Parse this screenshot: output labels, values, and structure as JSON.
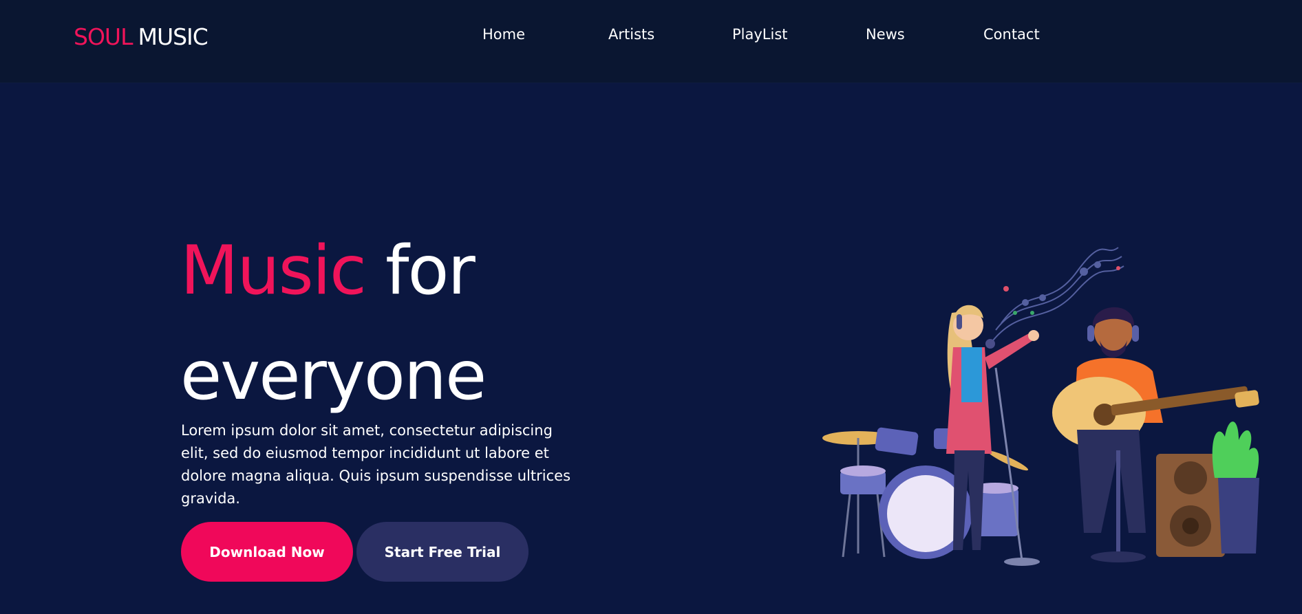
{
  "brand": {
    "part1": "SOUL",
    "part2": "MUSIC"
  },
  "nav": {
    "items": [
      {
        "label": "Home"
      },
      {
        "label": "Artists"
      },
      {
        "label": "PlayList"
      },
      {
        "label": "News"
      },
      {
        "label": "Contact"
      }
    ]
  },
  "hero": {
    "title_accent": "Music",
    "title_rest": "for",
    "title_line2": "everyone",
    "description": "Lorem ipsum dolor sit amet, consectetur adipiscing elit, sed do eiusmod tempor incididunt ut labore et dolore magna aliqua. Quis ipsum suspendisse ultrices gravida.",
    "primary_cta": "Download Now",
    "secondary_cta": "Start Free Trial"
  },
  "colors": {
    "background": "#0b1740",
    "navbar": "#0a1631",
    "accent": "#f0145a",
    "secondary_button": "#2a2f63"
  }
}
